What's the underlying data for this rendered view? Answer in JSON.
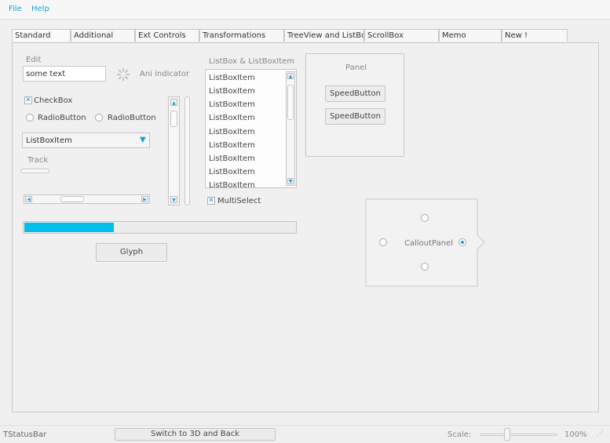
{
  "menu": {
    "file": "File",
    "help": "Help"
  },
  "tabs": [
    "Standard",
    "Additional",
    "Ext Controls",
    "Transformations",
    "TreeView and ListBox",
    "ScrollBox",
    "Memo",
    "New !"
  ],
  "edit": {
    "label": "Edit",
    "value": "some text"
  },
  "ani_indicator": {
    "label": "Ani indicator"
  },
  "checkbox": {
    "label": "CheckBox",
    "checked": true
  },
  "radios": [
    {
      "label": "RadioButton"
    },
    {
      "label": "RadioButton"
    }
  ],
  "combo": {
    "selected": "ListBoxItem"
  },
  "track": {
    "label": "Track"
  },
  "listbox": {
    "label": "ListBox & ListBoxItem",
    "items": [
      "ListBoxItem",
      "ListBoxItem",
      "ListBoxItem",
      "ListBoxItem",
      "ListBoxItem",
      "ListBoxItem",
      "ListBoxItem",
      "ListBoxItem",
      "ListBoxItem"
    ]
  },
  "multiselect": {
    "label": "MultiSelect",
    "checked": true
  },
  "panel": {
    "title": "Panel",
    "buttons": [
      "SpeedButton",
      "SpeedButton"
    ]
  },
  "progress": {
    "value": 0.33,
    "color": "#00bfea"
  },
  "glyph": {
    "label": "Glyph"
  },
  "callout": {
    "label": "CalloutPanel"
  },
  "status": {
    "label": "TStatusBar",
    "switch_button": "Switch to 3D and Back",
    "scale_label": "Scale:",
    "scale_value": "100%"
  },
  "colors": {
    "accent": "#1a9fd6",
    "progress": "#00bfea"
  }
}
